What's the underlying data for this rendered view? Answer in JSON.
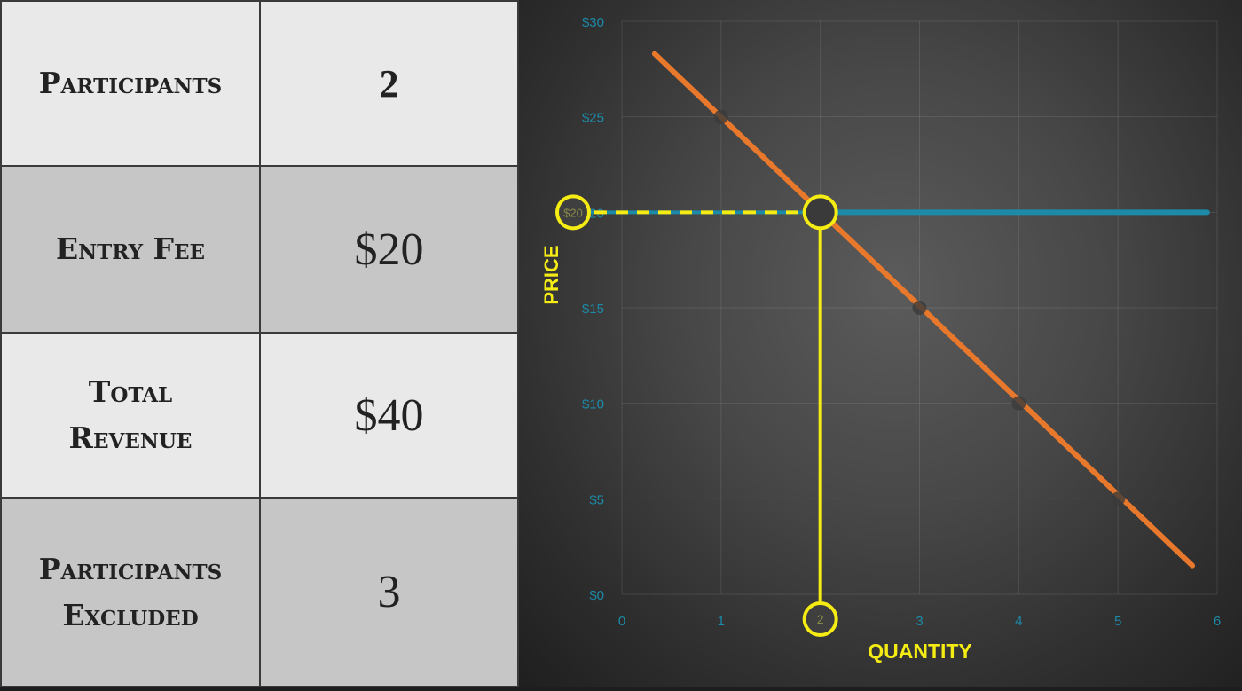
{
  "table": {
    "rows": [
      {
        "label_lines": [
          "Participants"
        ],
        "value": "2"
      },
      {
        "label_lines": [
          "Entry Fee"
        ],
        "value": "$20"
      },
      {
        "label_lines": [
          "Total",
          "Revenue"
        ],
        "value": "$40"
      },
      {
        "label_lines": [
          "Participants",
          "Excluded"
        ],
        "value": "3"
      }
    ]
  },
  "chart_data": {
    "type": "line",
    "xlabel": "QUANTITY",
    "ylabel": "PRICE",
    "x_ticks": [
      "0",
      "1",
      "2",
      "3",
      "4",
      "5",
      "6"
    ],
    "y_ticks": [
      "$0",
      "$5",
      "$10",
      "$15",
      "$20",
      "$25",
      "$30"
    ],
    "xlim": [
      0,
      6
    ],
    "ylim": [
      0,
      30
    ],
    "grid": true,
    "series": [
      {
        "kind": "demand",
        "color": "#e8782c",
        "x": [
          0.33,
          5.75
        ],
        "y": [
          28.3,
          1.5
        ]
      },
      {
        "kind": "price",
        "color": "#1d8aa8",
        "x": [
          2,
          5.9
        ],
        "y": [
          20,
          20
        ]
      }
    ],
    "demand_points": [
      {
        "x": 1,
        "y": 25
      },
      {
        "x": 3,
        "y": 15
      },
      {
        "x": 4,
        "y": 10
      },
      {
        "x": 5,
        "y": 5
      }
    ],
    "highlight": {
      "color": "#f5ec14",
      "x": 2,
      "y": 20,
      "y_label": "$20",
      "x_label": "2"
    },
    "colors": {
      "axis_tick": "#1d8aa8",
      "axis_title": "#f5ec14"
    }
  }
}
